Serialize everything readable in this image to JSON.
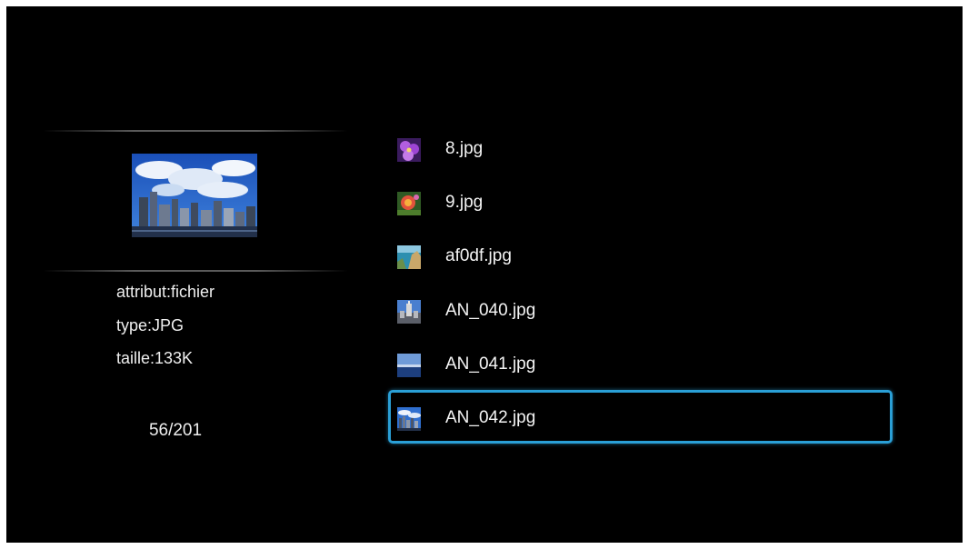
{
  "preview": {
    "icon": "city-skyline-image"
  },
  "info": {
    "attribute": "attribut:fichier",
    "type": "type:JPG",
    "size": "taille:133K"
  },
  "counter": "56/201",
  "files": [
    {
      "name": "8.jpg",
      "icon": "purple-flower-thumbnail"
    },
    {
      "name": "9.jpg",
      "icon": "red-flower-thumbnail"
    },
    {
      "name": "af0df.jpg",
      "icon": "coastline-thumbnail"
    },
    {
      "name": "AN_040.jpg",
      "icon": "building-thumbnail"
    },
    {
      "name": "AN_041.jpg",
      "icon": "seascape-thumbnail"
    },
    {
      "name": "AN_042.jpg",
      "icon": "city-skyline-thumbnail"
    }
  ],
  "selected_index": 5,
  "colors": {
    "background": "#000000",
    "selection_border": "#2a9fd6",
    "text": "#f2f2f2"
  }
}
